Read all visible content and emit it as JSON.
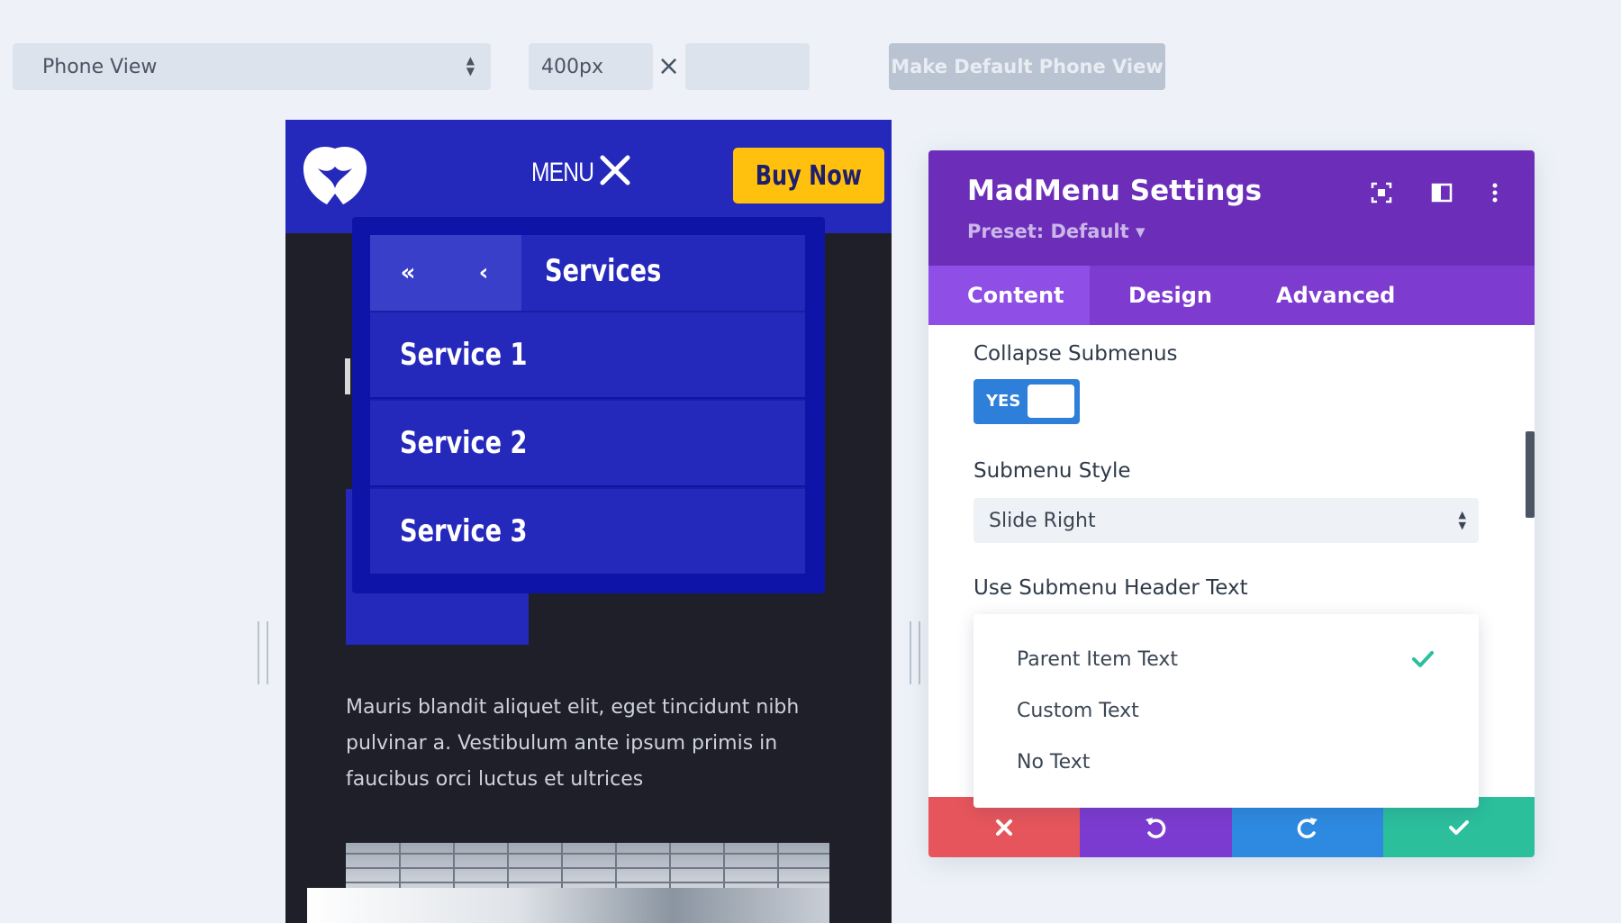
{
  "toolbar": {
    "view_select": "Phone View",
    "width_value": "400px",
    "times_glyph": "×",
    "height_value": "",
    "make_default_label": "Make Default Phone View"
  },
  "phone": {
    "menu_label": "MENU",
    "buy_now_label": "Buy Now",
    "body_text": "Mauris blandit aliquet elit, eget tincidunt nibh pulvinar a. Vestibulum ante ipsum primis in faucibus orci luctus et ultrices",
    "submenu": {
      "first_glyph": "«",
      "back_glyph": "‹",
      "title": "Services",
      "items": [
        "Service 1",
        "Service 2",
        "Service 3"
      ]
    }
  },
  "panel": {
    "title": "MadMenu Settings",
    "preset": "Preset: Default ▾",
    "tabs": [
      "Content",
      "Design",
      "Advanced"
    ],
    "active_tab": "Content",
    "collapse_label": "Collapse Submenus",
    "collapse_value": "YES",
    "submenu_style_label": "Submenu Style",
    "submenu_style_value": "Slide Right",
    "header_text_label": "Use Submenu Header Text",
    "header_text_options": [
      "Parent Item Text",
      "Custom Text",
      "No Text"
    ],
    "header_text_selected": "Parent Item Text"
  },
  "colors": {
    "phone_header": "#2428bb",
    "buy_now": "#ffc10e",
    "panel_header": "#6c2eb9",
    "tabs": "#7e3bd0",
    "toggle": "#2e7fd9",
    "cancel": "#e6555b",
    "undo": "#7c3bd0",
    "redo": "#2e8ae0",
    "save": "#2bbf9c"
  },
  "icons": {
    "view_select_arrows": "sort-arrows-icon",
    "menu_close": "close-icon",
    "panel_expand": "expand-icon",
    "panel_columns": "columns-icon",
    "panel_more": "more-vertical-icon",
    "check": "check-icon",
    "cancel": "close-icon",
    "undo": "undo-icon",
    "redo": "redo-icon",
    "save": "check-icon"
  }
}
